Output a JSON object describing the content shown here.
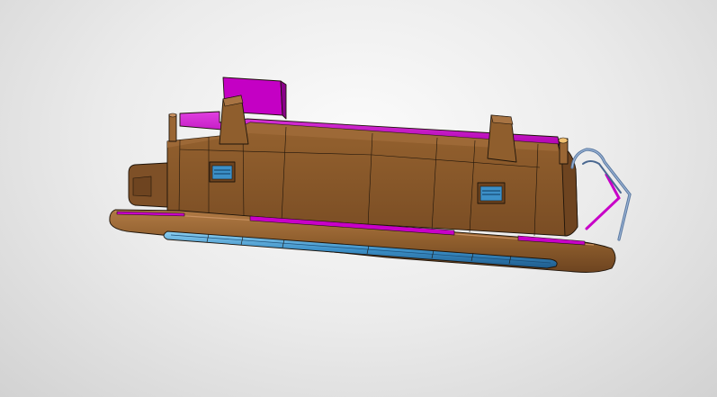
{
  "viewer": {
    "background": "#e4e4e4",
    "model_colors": {
      "housing": "#8b5a2b",
      "housing_light": "#a87443",
      "housing_dark": "#6e4420",
      "seal": "#c800c8",
      "lens": "#3c90c8",
      "clip": "#5a78a0"
    },
    "icons": [
      "cad-model",
      "spring-clip-icon",
      "led-lens-strip"
    ]
  }
}
